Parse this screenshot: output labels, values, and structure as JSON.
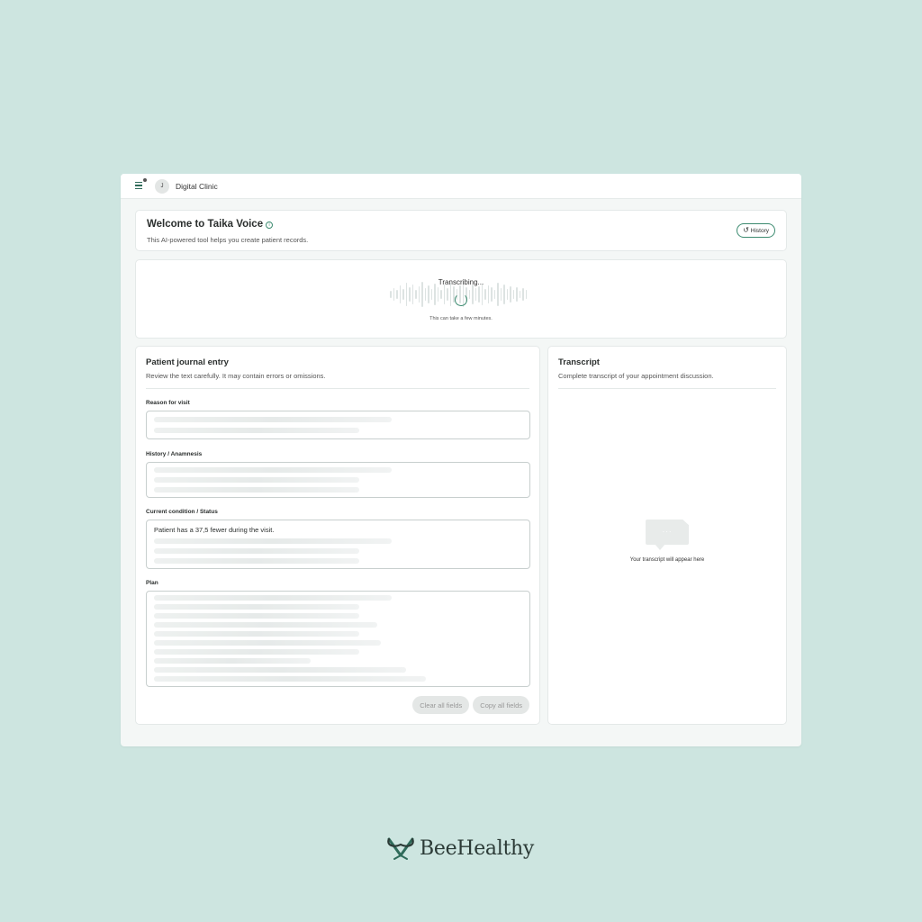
{
  "topbar": {
    "avatar_initial": "J",
    "clinic_name": "Digital Clinic"
  },
  "welcome": {
    "title": "Welcome to Taika Voice",
    "subtitle": "This AI-powered tool helps you create patient records.",
    "history_label": "History"
  },
  "status": {
    "label": "Transcribing...",
    "sub": "This can take a few minutes."
  },
  "journal": {
    "title": "Patient journal entry",
    "subtitle": "Review the text carefully. It may contain errors or omissions.",
    "fields": [
      {
        "label": "Reason for visit",
        "text": ""
      },
      {
        "label": "History / Anamnesis",
        "text": ""
      },
      {
        "label": "Current condition / Status",
        "text": "Patient has a 37,5 fewer during the visit."
      },
      {
        "label": "Plan",
        "text": ""
      }
    ],
    "clear_label": "Clear all fields",
    "copy_label": "Copy all fields"
  },
  "transcript": {
    "title": "Transcript",
    "subtitle": "Complete transcript of your appointment discussion.",
    "empty_text": "Your transcript will appear here"
  },
  "brand": {
    "name": "BeeHealthy"
  },
  "colors": {
    "background": "#cde5e0",
    "accent": "#3c8b70",
    "button_disabled_bg": "#e4e7e6"
  },
  "icons": [
    "menu-icon",
    "info-icon",
    "history-icon",
    "spinner-icon",
    "chat-bubble-icon",
    "brand-logo-icon"
  ]
}
